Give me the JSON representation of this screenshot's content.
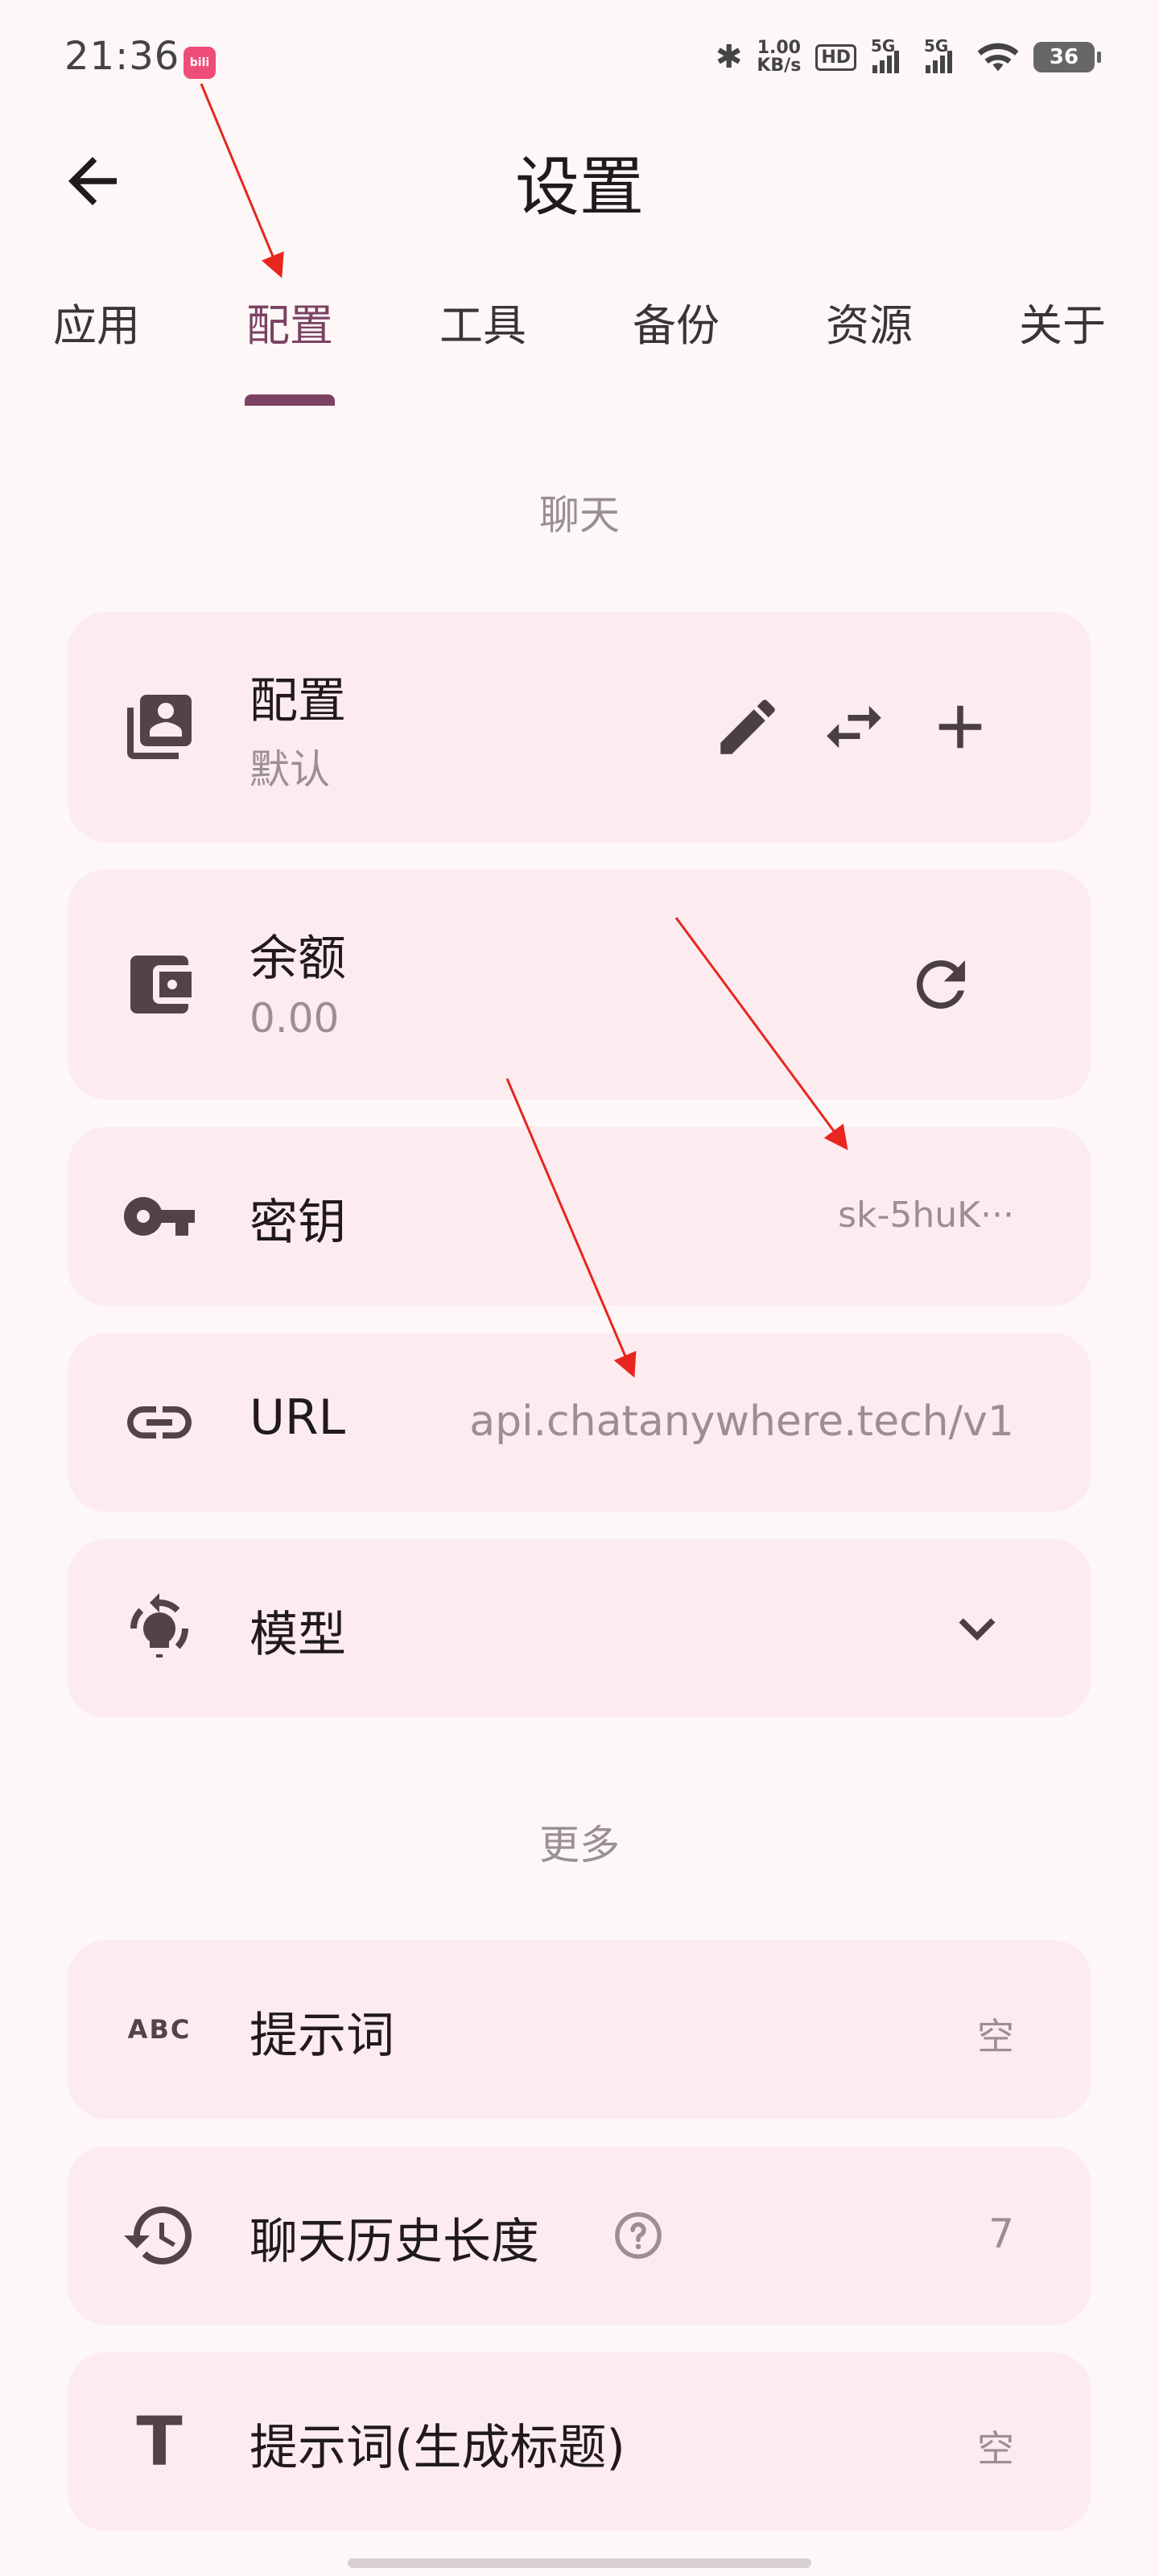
{
  "status_bar": {
    "time": "21:36",
    "app_badge_text": "bili",
    "net_speed_value": "1.00",
    "net_speed_unit": "KB/s",
    "hd_label": "HD",
    "sim1_label": "5G",
    "sim2_label": "5G",
    "battery": "36"
  },
  "header": {
    "title": "设置",
    "back_icon": "arrow-back-icon"
  },
  "tabs": [
    {
      "label": "应用",
      "active": false
    },
    {
      "label": "配置",
      "active": true
    },
    {
      "label": "工具",
      "active": false
    },
    {
      "label": "备份",
      "active": false
    },
    {
      "label": "资源",
      "active": false
    },
    {
      "label": "关于",
      "active": false
    }
  ],
  "sections": {
    "chat": {
      "header": "聊天",
      "profile": {
        "title": "配置",
        "subtitle": "默认",
        "icon": "account-box-multiple-icon",
        "actions": [
          "edit-icon",
          "swap-icon",
          "add-icon"
        ]
      },
      "balance": {
        "title": "余额",
        "subtitle": "0.00",
        "icon": "wallet-icon",
        "action": "refresh-icon"
      },
      "api_key": {
        "title": "密钥",
        "value": "sk-5huK···",
        "icon": "key-icon"
      },
      "url": {
        "title": "URL",
        "value": "api.chatanywhere.tech/v1",
        "icon": "link-icon"
      },
      "model": {
        "title": "模型",
        "icon": "model-icon",
        "action": "chevron-down-icon"
      }
    },
    "more": {
      "header": "更多",
      "prompt": {
        "title": "提示词",
        "value": "空",
        "icon": "abc-icon",
        "icon_text": "ABC"
      },
      "history": {
        "title": "聊天历史长度",
        "value": "7",
        "icon": "history-icon",
        "help": "help-circle-icon"
      },
      "title_prompt": {
        "title": "提示词(生成标题)",
        "value": "空",
        "icon": "text-t-icon",
        "icon_text": "T"
      }
    }
  },
  "colors": {
    "background": "#fdf7f8",
    "card": "#fcecef",
    "accent": "#7b4262",
    "secondary_text": "#9a8f92",
    "annotation_arrow": "#e8251f"
  }
}
